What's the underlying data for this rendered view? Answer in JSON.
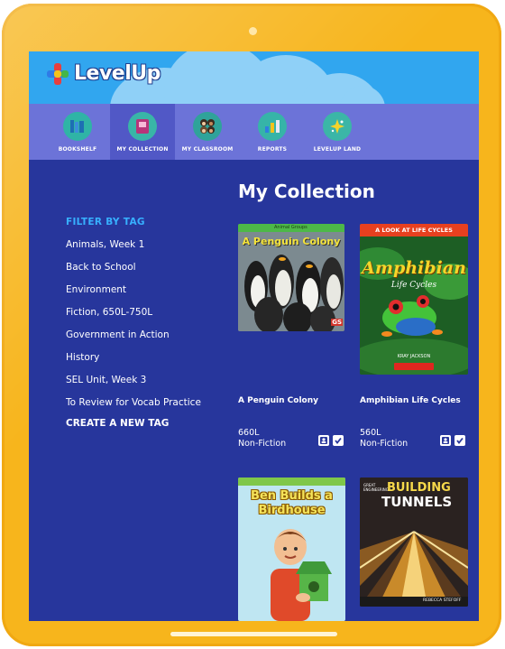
{
  "app": {
    "logo_text": "LevelUp"
  },
  "nav": [
    {
      "label": "BOOKSHELF",
      "icon": "bookshelf-icon"
    },
    {
      "label": "MY COLLECTION",
      "icon": "collection-icon",
      "active": true
    },
    {
      "label": "MY CLASSROOM",
      "icon": "classroom-icon"
    },
    {
      "label": "REPORTS",
      "icon": "reports-icon"
    },
    {
      "label": "LEVELUP LAND",
      "icon": "levelup-land-icon"
    }
  ],
  "main": {
    "title": "My Collection"
  },
  "filters": {
    "title": "FILTER BY TAG",
    "tags": [
      "Animals, Week 1",
      "Back to School",
      "Environment",
      "Fiction, 650L-750L",
      "Government in Action",
      "History",
      "SEL Unit, Week 3",
      "To Review for Vocab Practice"
    ],
    "create_label": "CREATE A NEW TAG"
  },
  "books": [
    {
      "title": "A Penguin Colony",
      "level": "660L",
      "genre": "Non-Fiction",
      "cover_title": "A Penguin Colony",
      "cover_series": "Animal Groups"
    },
    {
      "title": "Amphibian Life Cycles",
      "level": "560L",
      "genre": "Non-Fiction",
      "cover_banner": "A LOOK AT LIFE CYCLES",
      "cover_title": "Amphibian",
      "cover_subtitle": "Life Cycles",
      "cover_author": "KRAY JACKSON"
    },
    {
      "title": "Ben Builds a Birdhouse",
      "cover_title": "Ben Builds a Birdhouse"
    },
    {
      "title": "Building Tunnels",
      "cover_title_1": "BUILDING",
      "cover_title_2": "TUNNELS",
      "cover_series": "GREAT ENGINEERING",
      "cover_author": "REBECCA STEFOFF"
    }
  ],
  "colors": {
    "frame": "#f7b51c",
    "screen": "#27369c",
    "header": "#31a6ef",
    "nav": "#6c73d8",
    "accent": "#37b0ff"
  }
}
